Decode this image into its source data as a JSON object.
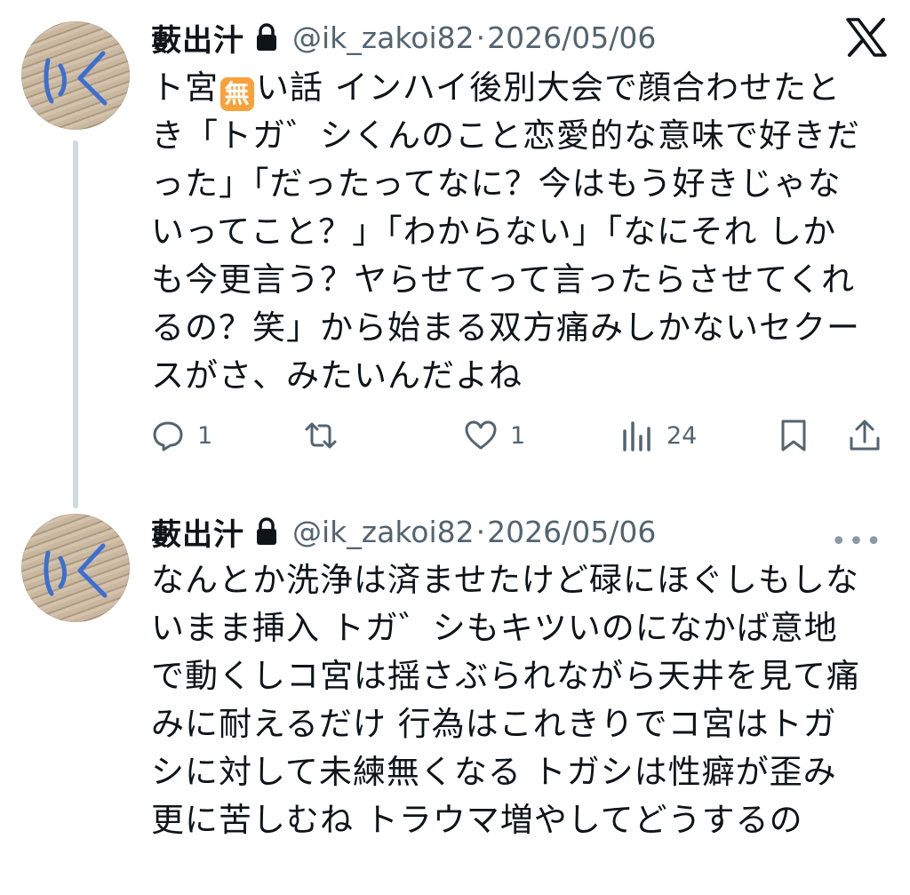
{
  "tweets": [
    {
      "author": {
        "display_name": "藪出汁",
        "handle": "@ik_zakoi82",
        "avatar_text": "いく",
        "protected_icon": "lock-icon"
      },
      "separator": "·",
      "date": "2026/05/06",
      "text_before_emoji": "ト宮",
      "emoji": "無",
      "text_after_emoji": "い話 インハイ後別大会で顔合わせたとき「トガ゛シくんのこと恋愛的な意味で好きだった」「だったってなに？今はもう好きじゃないってこと？」「わからない」「なにそれ しかも今更言う？ヤらせてって言ったらさせてくれるの？笑」から始まる双方痛みしかないセクースがさ、みたいんだよね",
      "actions": {
        "reply_count": "1",
        "retweet_count": "",
        "like_count": "1",
        "views_count": "24"
      },
      "brand_icon": "x-logo-icon"
    },
    {
      "author": {
        "display_name": "藪出汁",
        "handle": "@ik_zakoi82",
        "avatar_text": "いく",
        "protected_icon": "lock-icon"
      },
      "separator": "·",
      "date": "2026/05/06",
      "text": "なんとか洗浄は済ませたけど碌にほぐしもしないまま挿入 トガ゛シもキツいのになかば意地で動くしコ宮は揺さぶられながら天井を見て痛みに耐えるだけ 行為はこれきりでコ宮はトガシに対して未練無くなる トガシは性癖が歪み更に苦しむね トラウマ増やしてどうするの",
      "more_icon": "more-horizontal-icon",
      "more_glyph": "•••"
    }
  ],
  "colors": {
    "text": "#0f1419",
    "secondary": "#536471",
    "thread_line": "#cfd9de",
    "emoji_bg": "#f7a23a",
    "avatar_ink": "#3b6fd1"
  }
}
